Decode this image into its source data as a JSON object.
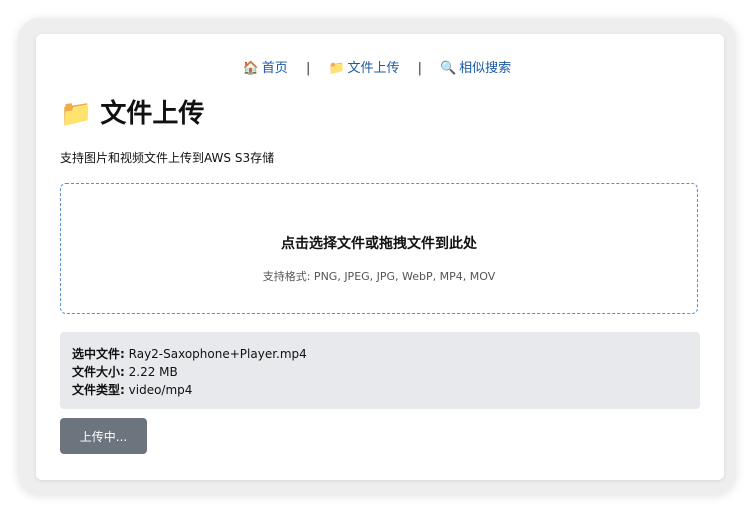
{
  "nav": {
    "items": [
      {
        "icon": "house-icon",
        "glyph": "🏠",
        "label": "首页"
      },
      {
        "icon": "folder-icon",
        "glyph": "📁",
        "label": "文件上传"
      },
      {
        "icon": "magnifier-icon",
        "glyph": "🔍",
        "label": "相似搜索"
      }
    ],
    "separator": "|"
  },
  "page": {
    "title_icon": "📁",
    "title": "文件上传",
    "subtitle": "支持图片和视频文件上传到AWS S3存储"
  },
  "dropzone": {
    "main_text": "点击选择文件或拖拽文件到此处",
    "hint": "支持格式: PNG, JPEG, JPG, WebP, MP4, MOV"
  },
  "file_info": {
    "name_label": "选中文件:",
    "name_value": "Ray2-Saxophone+Player.mp4",
    "size_label": "文件大小:",
    "size_value": "2.22 MB",
    "type_label": "文件类型:",
    "type_value": "video/mp4"
  },
  "upload_button": {
    "label": "上传中..."
  },
  "colors": {
    "link": "#1a5aa6",
    "button": "#6c757d",
    "info_bg": "#e7e9ec",
    "dropzone_border": "#5a8fd0"
  }
}
